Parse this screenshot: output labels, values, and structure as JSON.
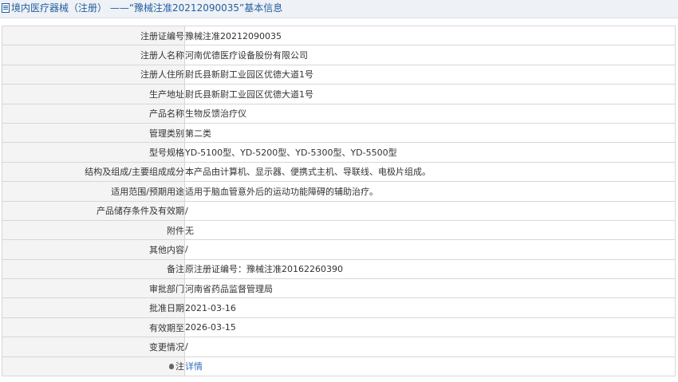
{
  "header": {
    "title": "境内医疗器械（注册） ——“豫械注准20212090035”基本信息"
  },
  "rows": [
    {
      "label": "注册证编号",
      "value": "豫械注准20212090035"
    },
    {
      "label": "注册人名称",
      "value": "河南优德医疗设备股份有限公司"
    },
    {
      "label": "注册人住所",
      "value": "尉氏县新尉工业园区优德大道1号"
    },
    {
      "label": "生产地址",
      "value": "尉氏县新尉工业园区优德大道1号"
    },
    {
      "label": "产品名称",
      "value": "生物反馈治疗仪"
    },
    {
      "label": "管理类别",
      "value": "第二类"
    },
    {
      "label": "型号规格",
      "value": "YD-5100型、YD-5200型、YD-5300型、YD-5500型"
    },
    {
      "label": "结构及组成/主要组成成分",
      "value": "本产品由计算机、显示器、便携式主机、导联线、电极片组成。"
    },
    {
      "label": "适用范围/预期用途",
      "value": "适用于脑血管意外后的运动功能障碍的辅助治疗。"
    },
    {
      "label": "产品储存条件及有效期",
      "value": "/"
    },
    {
      "label": "附件",
      "value": "无"
    },
    {
      "label": "其他内容",
      "value": "/"
    },
    {
      "label": "备注",
      "value": "原注册证编号：豫械注准20162260390"
    },
    {
      "label": "审批部门",
      "value": "河南省药品监督管理局"
    },
    {
      "label": "批准日期",
      "value": "2021-03-16"
    },
    {
      "label": "有效期至",
      "value": "2026-03-15"
    },
    {
      "label": "变更情况",
      "value": "/"
    }
  ],
  "note_row": {
    "label": "注",
    "icon": "bulb-icon",
    "link_text": "详情"
  }
}
